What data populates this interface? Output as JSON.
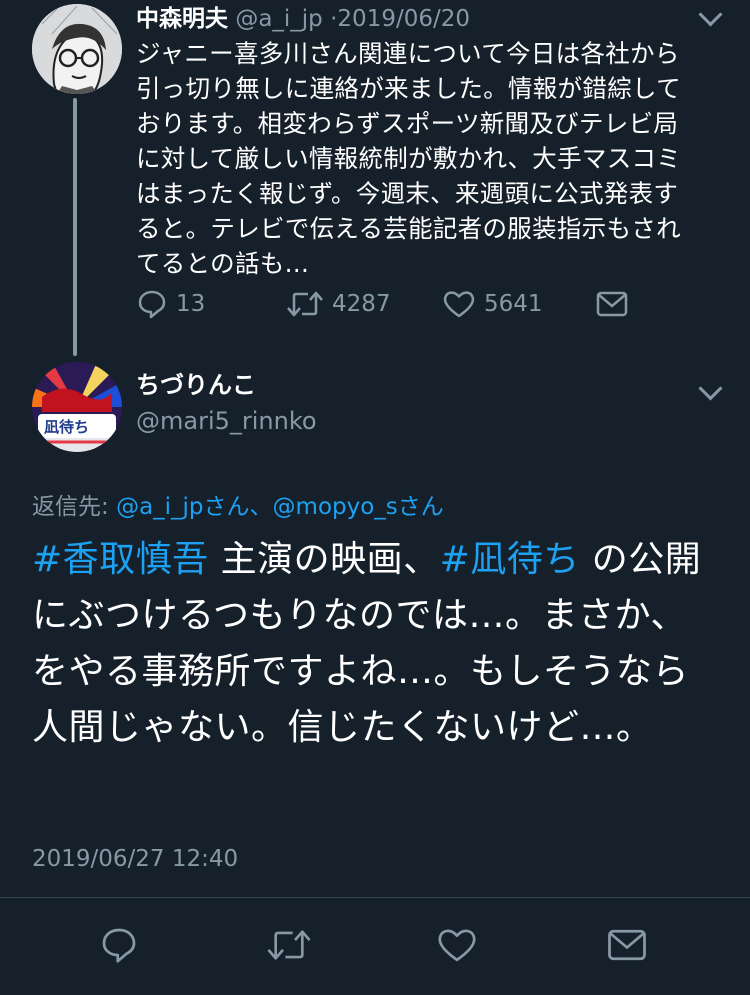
{
  "parent_tweet": {
    "display_name": "中森明夫",
    "handle": "@a_i_jp",
    "separator": "·",
    "date": "2019/06/20",
    "text": "ジャニー喜多川さん関連について今日は各社から\n引っ切り無しに連絡が来ました。情報が錯綜して\nおります。相変わらずスポーツ新聞及びテレビ局\nに対して厳しい情報統制が敷かれ、大手マスコミ\nはまったく報じず。今週末、来週頭に公式発表す\nると。テレビで伝える芸能記者の服装指示もされ\nてるとの話も…",
    "reply_count": "13",
    "retweet_count": "4287",
    "like_count": "5641",
    "icons": [
      "reply-icon",
      "retweet-icon",
      "like-icon",
      "share-icon",
      "chevron-down-icon"
    ]
  },
  "reply_tweet": {
    "display_name": "ちづりんこ",
    "handle": "@mari5_rinnko",
    "avatar_text": "凪待ち",
    "replying_to_label": "返信先: ",
    "replying_to_users": "@a_i_jpさん、@mopyo_sさん",
    "text_parts": {
      "hashtag1": "#香取慎吾",
      "part1": " 主演の映画、",
      "hashtag2": "#凪待ち",
      "part2": " の公開にぶつけるつもりなのでは…。まさか、をやる事務所ですよね…。もしそうなら人間じゃない。信じたくないけど…。"
    },
    "timestamp": "2019/06/27 12:40",
    "icons": [
      "reply-icon",
      "retweet-icon",
      "like-icon",
      "share-icon",
      "chevron-down-icon"
    ]
  },
  "colors": {
    "background": "#15202b",
    "text": "#ffffff",
    "muted": "#8899a6",
    "link": "#1da1f2",
    "divider": "#38444d"
  }
}
